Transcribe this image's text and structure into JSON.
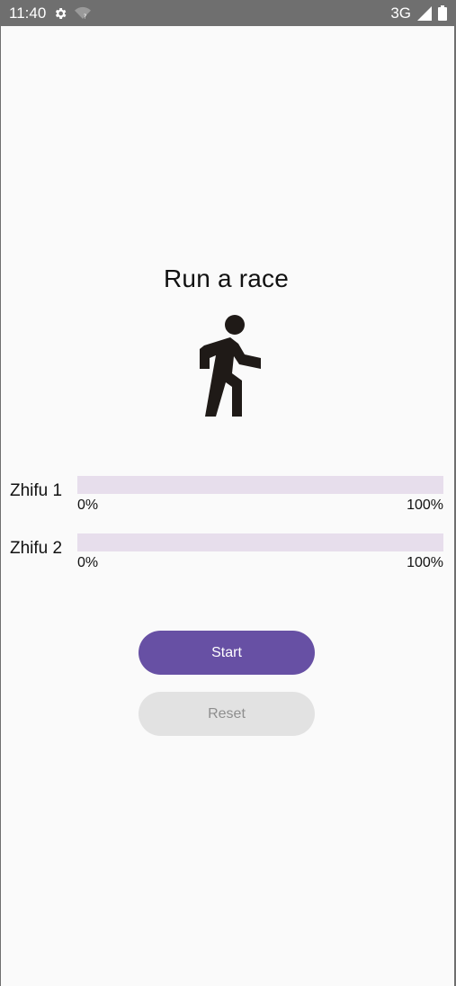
{
  "status_bar": {
    "time": "11:40",
    "network": "3G",
    "icons": [
      "gear-icon",
      "wifi-question-icon",
      "signal-icon",
      "battery-icon"
    ]
  },
  "title": "Run a race",
  "hero_icon": "walking-person-icon",
  "racers": [
    {
      "name": "Zhifu 1",
      "progress_fraction": 0,
      "min_label": "0%",
      "max_label": "100%"
    },
    {
      "name": "Zhifu 2",
      "progress_fraction": 0,
      "min_label": "0%",
      "max_label": "100%"
    }
  ],
  "buttons": {
    "start_label": "Start",
    "reset_label": "Reset"
  },
  "colors": {
    "accent": "#6750a4",
    "track": "#e7deec",
    "disabled_button": "#e2e2e2",
    "status_bar": "#6f6f6f"
  }
}
